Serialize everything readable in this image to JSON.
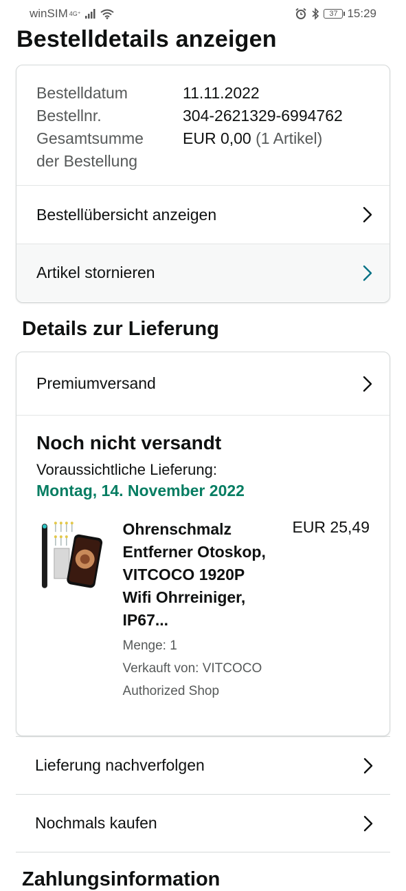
{
  "status_bar": {
    "carrier": "winSIM",
    "network": "4G⁺",
    "battery": "37",
    "time": "15:29"
  },
  "page_title": "Bestelldetails anzeigen",
  "order_summary": {
    "date_label": "Bestelldatum",
    "date_value": "11.11.2022",
    "number_label": "Bestellnr.",
    "number_value": "304-2621329-6994762",
    "total_label_line1": "Gesamtsumme",
    "total_label_line2": "der Bestellung",
    "total_value": "EUR 0,00",
    "total_items": "(1 Artikel)",
    "view_summary_label": "Bestellübersicht anzeigen",
    "cancel_items_label": "Artikel stornieren"
  },
  "delivery": {
    "section_title": "Details zur Lieferung",
    "shipping_method": "Premiumversand",
    "status": "Noch nicht versandt",
    "eta_label": "Voraussichtliche Lieferung:",
    "eta_date": "Montag, 14. November 2022",
    "item": {
      "title_lines": [
        "Ohrenschmalz",
        "Entferner Otoskop,",
        "VITCOCO 1920P",
        "Wifi Ohrreiniger,",
        "IP67..."
      ],
      "price": "EUR 25,49",
      "quantity": "Menge: 1",
      "sold_by": "Verkauft von: VITCOCO Authorized Shop"
    }
  },
  "actions": {
    "track": "Lieferung nachverfolgen",
    "buy_again": "Nochmals kaufen"
  },
  "payment_title": "Zahlungsinformation",
  "colors": {
    "eta_green": "#067d62",
    "teal_chevron": "#007185",
    "border": "#d5d9d9"
  }
}
